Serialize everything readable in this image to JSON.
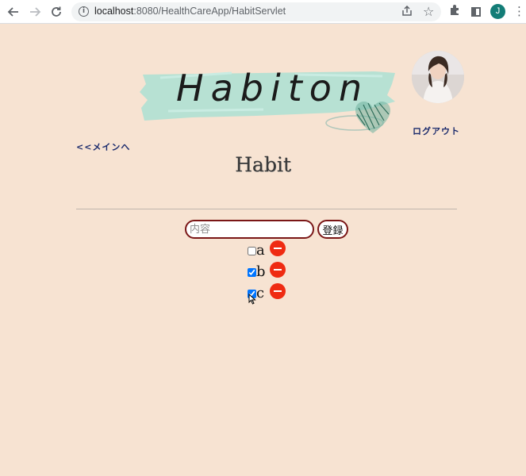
{
  "browser": {
    "url_host": "localhost",
    "url_rest": ":8080/HealthCareApp/HabitServlet",
    "profile_initial": "J",
    "icons": [
      "back-arrow-icon",
      "forward-arrow-icon",
      "reload-icon",
      "info-icon",
      "share-icon",
      "star-icon",
      "extensions-icon",
      "side-panel-icon",
      "menu-icon"
    ]
  },
  "header": {
    "logo_text": "Habiton",
    "logout_label": "ログアウト",
    "back_label": "<<メインへ"
  },
  "main": {
    "title": "Habit",
    "input_placeholder": "内容",
    "input_value": "",
    "register_label": "登録",
    "habits": [
      {
        "label": "a",
        "checked": false
      },
      {
        "label": "b",
        "checked": true
      },
      {
        "label": "c",
        "checked": true
      }
    ]
  },
  "colors": {
    "background": "#f7e3d2",
    "accent_border": "#7a1616",
    "delete_button": "#ef2b12",
    "link": "#1a2a6c",
    "logo_brush": "#b3e0d3"
  }
}
